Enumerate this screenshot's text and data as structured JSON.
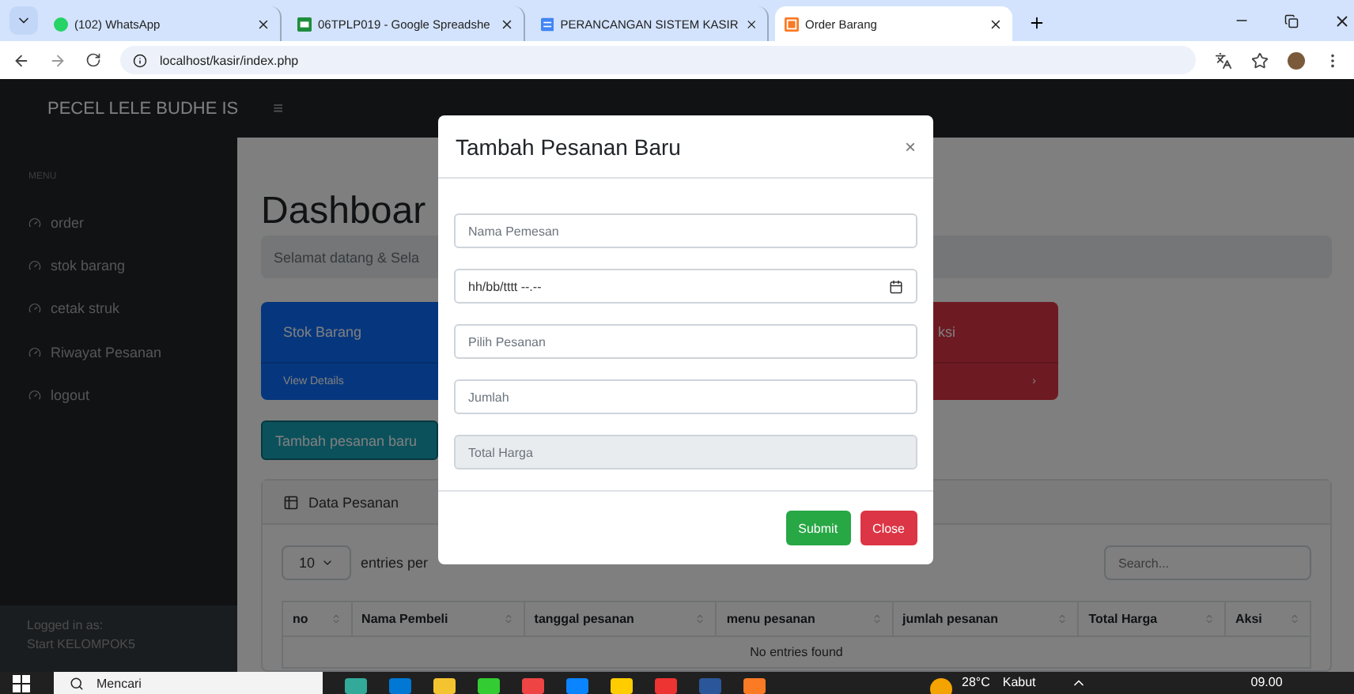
{
  "browser": {
    "tabs": [
      {
        "title": "(102) WhatsApp",
        "kind": "chat",
        "selected": false
      },
      {
        "title": "06TPLP019 - Google Spreadshe",
        "kind": "sheet",
        "selected": false
      },
      {
        "title": "PERANCANGAN SISTEM KASIR",
        "kind": "doc",
        "selected": false
      },
      {
        "title": "Order Barang",
        "kind": "app",
        "selected": true
      }
    ],
    "url": "localhost/kasir/index.php"
  },
  "navbar": {
    "brand": "PECEL LELE BUDHE IS",
    "toggle": "≡"
  },
  "sidebar": {
    "heading": "MENU",
    "items": [
      "order",
      "stok barang",
      "cetak struk",
      "Riwayat Pesanan",
      "logout"
    ],
    "footer_label": "Logged in as:",
    "footer_user": "Start KELOMPOK5"
  },
  "main": {
    "title": "Dashboar",
    "breadcrumb": "Selamat datang & Sela",
    "cards": [
      {
        "title": "Stok Barang",
        "link": "View Details",
        "kind": "primary"
      },
      {
        "title": "ksi",
        "kind": "danger",
        "chevron": "›"
      }
    ],
    "add_button": "Tambah pesanan baru",
    "data_card": {
      "title": "Data Pesanan",
      "page_length": "10",
      "entries_text": "entries per",
      "search_placeholder": "Search...",
      "columns": [
        "no",
        "Nama Pembeli",
        "tanggal pesanan",
        "menu pesanan",
        "jumlah pesanan",
        "Total Harga",
        "Aksi"
      ],
      "empty": "No entries found"
    }
  },
  "modal": {
    "title": "Tambah Pesanan Baru",
    "close": "×",
    "fields": [
      {
        "kind": "text",
        "placeholder": "Nama Pemesan",
        "disabled": false
      },
      {
        "kind": "date",
        "placeholder": "hh/bb/tttt --.--",
        "disabled": false
      },
      {
        "kind": "text",
        "placeholder": "Pilih Pesanan",
        "disabled": false
      },
      {
        "kind": "text",
        "placeholder": "Jumlah",
        "disabled": false
      },
      {
        "kind": "text",
        "placeholder": "Total Harga",
        "disabled": true
      }
    ],
    "buttons": [
      {
        "label": "Submit",
        "kind": "primary"
      },
      {
        "label": "Close",
        "kind": "danger"
      }
    ]
  },
  "taskbar": {
    "search_placeholder": "Mencari",
    "temperature": "28°C",
    "weather": "Kabut",
    "time": "09.00"
  }
}
